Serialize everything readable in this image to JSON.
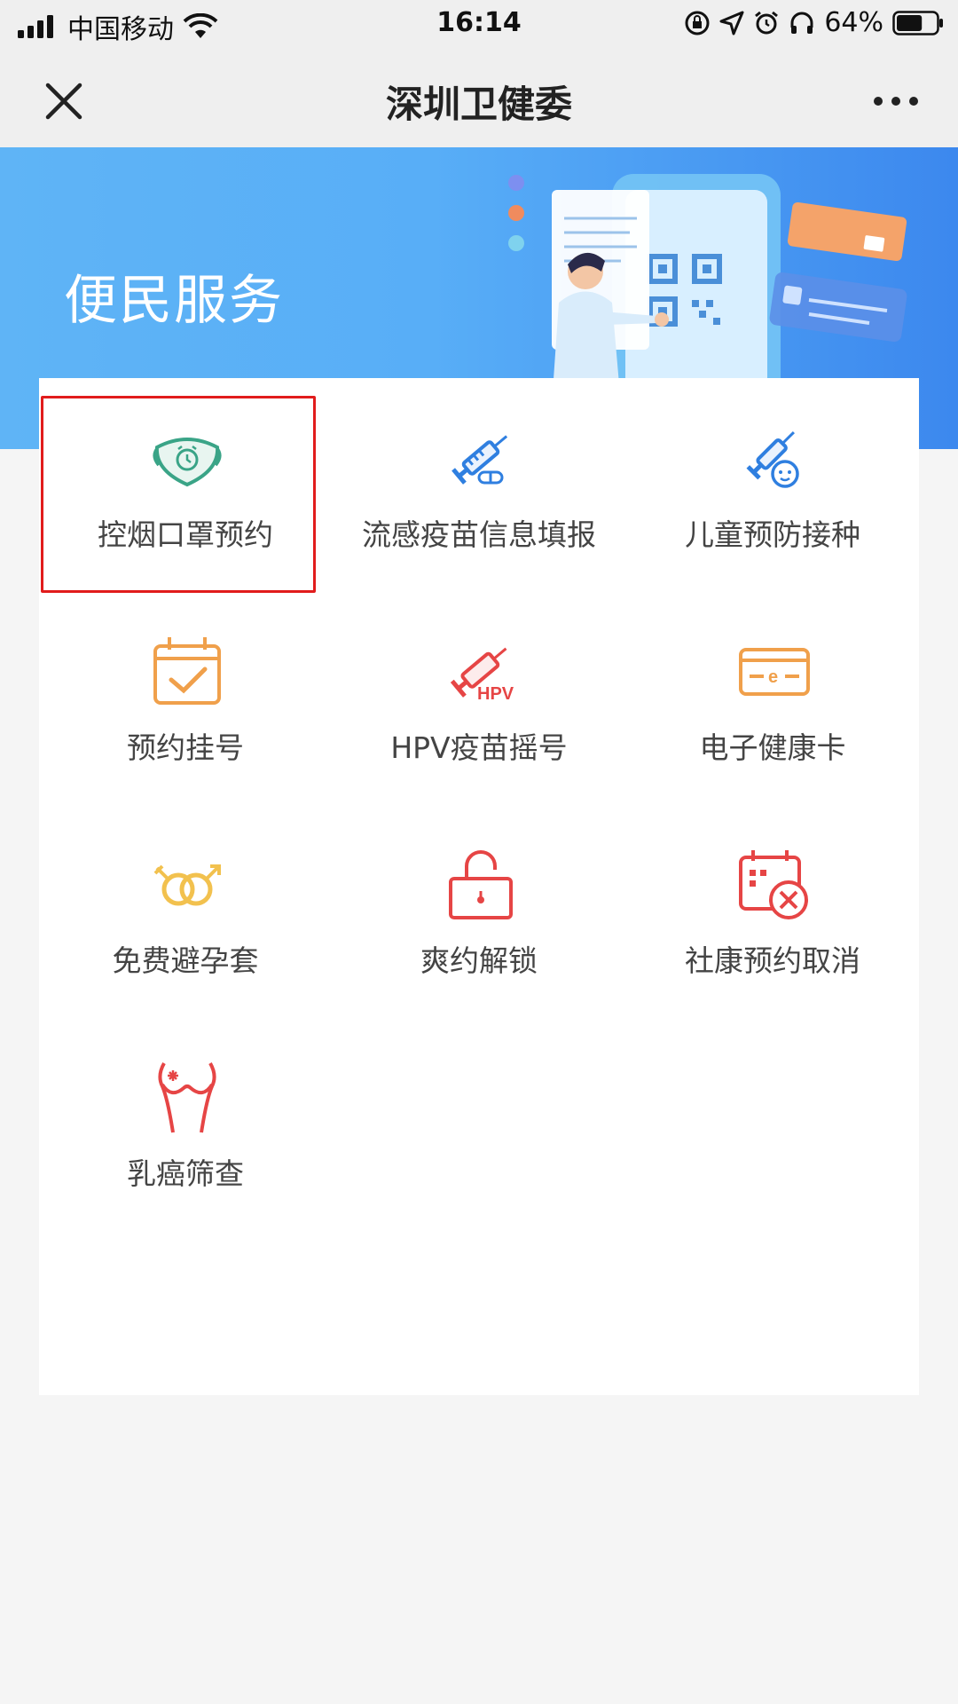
{
  "status_bar": {
    "carrier": "中国移动",
    "time": "16:14",
    "battery": "64%",
    "battery_level": 0.64,
    "icons": [
      "signal-icon",
      "wifi-icon",
      "orientation-lock-icon",
      "location-icon",
      "alarm-icon",
      "headphones-icon",
      "battery-icon"
    ]
  },
  "nav": {
    "title": "深圳卫健委",
    "left_icon": "close-icon",
    "right_icon": "more-icon"
  },
  "banner": {
    "title": "便民服务"
  },
  "services": [
    {
      "label": "控烟口罩预约",
      "icon": "mask-icon",
      "color": "#3aa487",
      "selected": true
    },
    {
      "label": "流感疫苗信息填报",
      "icon": "syringe-icon",
      "color": "#2f7fe0"
    },
    {
      "label": "儿童预防接种",
      "icon": "child-vaccine-icon",
      "color": "#2f7fe0"
    },
    {
      "label": "预约挂号",
      "icon": "calendar-check-icon",
      "color": "#f0a04b"
    },
    {
      "label": "HPV疫苗摇号",
      "icon": "hpv-syringe-icon",
      "color": "#e64545"
    },
    {
      "label": "电子健康卡",
      "icon": "health-card-icon",
      "color": "#f0a04b"
    },
    {
      "label": "免费避孕套",
      "icon": "gender-rings-icon",
      "color": "#f2c14e"
    },
    {
      "label": "爽约解锁",
      "icon": "unlock-icon",
      "color": "#e64545"
    },
    {
      "label": "社康预约取消",
      "icon": "calendar-cancel-icon",
      "color": "#e64545"
    },
    {
      "label": "乳癌筛查",
      "icon": "breast-screening-icon",
      "color": "#e64545"
    }
  ],
  "colors": {
    "accent_blue": "#4a9ff2",
    "highlight_red": "#e11c1c"
  }
}
